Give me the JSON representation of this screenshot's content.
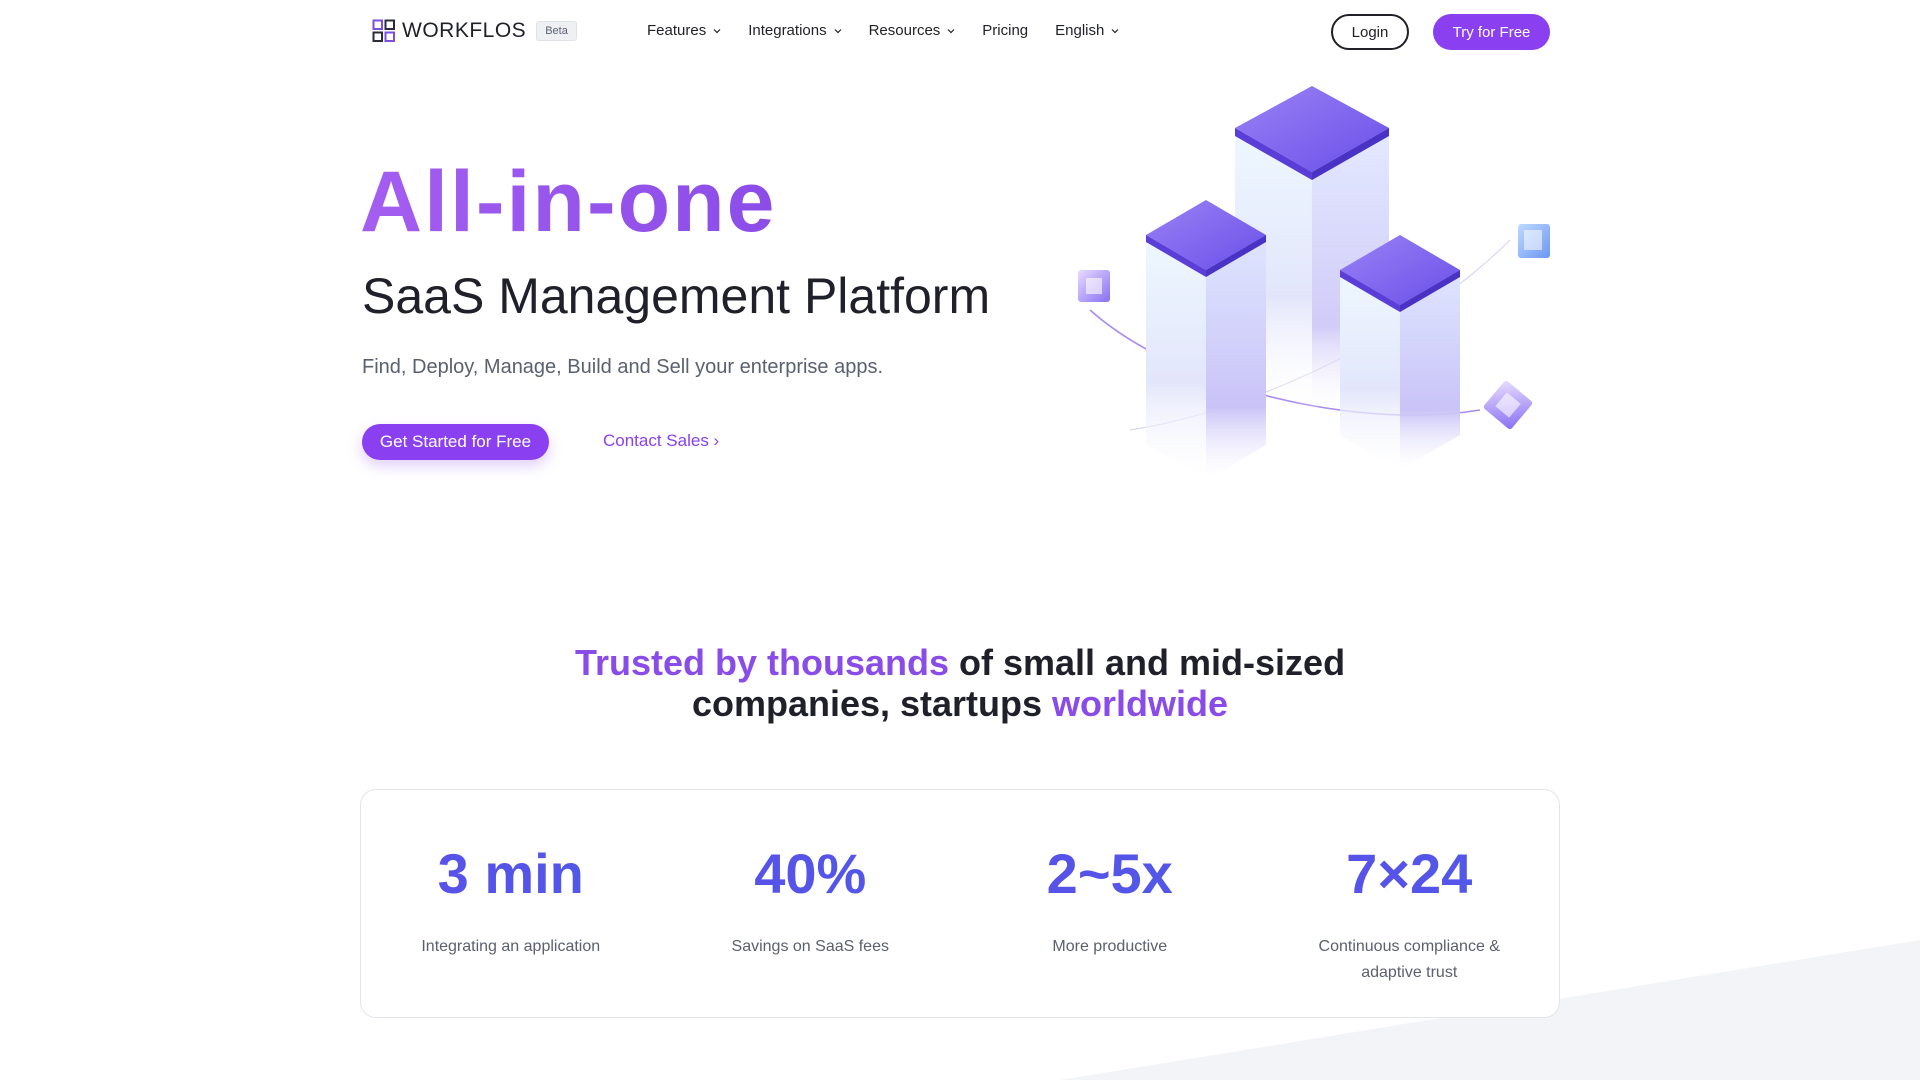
{
  "nav": {
    "brand": "WORKFLOS",
    "badge": "Beta",
    "menu": [
      {
        "label": "Features",
        "icon": "chevron-down-icon"
      },
      {
        "label": "Integrations",
        "icon": "chevron-down-icon"
      },
      {
        "label": "Resources",
        "icon": "chevron-down-icon"
      },
      {
        "label": "Pricing"
      },
      {
        "label": "English",
        "icon": "chevron-down-icon"
      }
    ],
    "login_label": "Login",
    "try_label": "Try for Free"
  },
  "hero": {
    "title": "All-in-one",
    "subtitle": "SaaS Management Platform",
    "description": "Find, Deploy, Manage, Build and Sell your enterprise apps.",
    "primary_cta": "Get Started for Free",
    "secondary_cta": "Contact Sales ›"
  },
  "trust": {
    "accent_1": "Trusted by thousands",
    "text_1": " of small and mid-sized",
    "text_2": "companies, startups ",
    "accent_2": "worldwide"
  },
  "stats": [
    {
      "value": "3 min",
      "label": "Integrating an application"
    },
    {
      "value": "40%",
      "label": "Savings on SaaS fees"
    },
    {
      "value": "2~5x",
      "label": "More productive"
    },
    {
      "value": "7×24",
      "label": "Continuous compliance & adaptive trust"
    }
  ],
  "colors": {
    "accent": "#8a3ff0",
    "text": "#1f2029",
    "muted": "#5b6070",
    "stat_gradient": "#5b4ee8"
  }
}
